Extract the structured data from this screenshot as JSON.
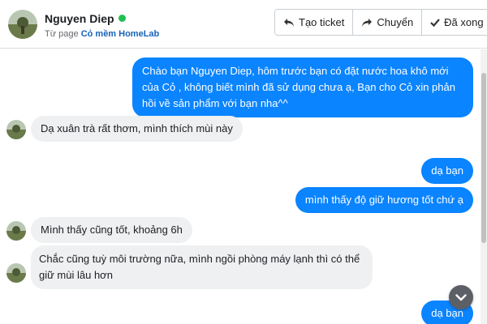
{
  "header": {
    "contact_name": "Nguyen Diep",
    "online": true,
    "source_prefix": "Từ page",
    "page_name": "Cỏ mềm HomeLab",
    "buttons": {
      "create_ticket": "Tạo ticket",
      "transfer": "Chuyển",
      "done": "Đã xong"
    }
  },
  "messages": [
    {
      "direction": "outgoing",
      "text": "Chào bạn Nguyen Diep, hôm trước bạn có đặt nước hoa khô mới của Cỏ , không biết mình đã sử dụng chưa ạ, Bạn cho Cỏ xin phản hồi về sản phẩm với bạn nha^^"
    },
    {
      "direction": "incoming",
      "text": "Dạ xuân trà rất thơm, mình thích mùi này"
    },
    {
      "direction": "outgoing",
      "text": "dạ bạn"
    },
    {
      "direction": "outgoing",
      "text": "mình thấy độ giữ hương tốt chứ ạ"
    },
    {
      "direction": "incoming",
      "text": "Mình thấy cũng tốt, khoảng 6h"
    },
    {
      "direction": "incoming",
      "text": "Chắc cũng tuỳ môi trường nữa, mình ngồi phòng máy lạnh thì có thể giữ mùi lâu hơn"
    },
    {
      "direction": "outgoing",
      "text": "dạ bạn"
    }
  ],
  "colors": {
    "outgoing_bubble": "#0a84ff",
    "incoming_bubble": "#eef0f2",
    "online_dot": "#20c050",
    "page_link": "#1762b8"
  },
  "icons": {
    "create_ticket": "reply-arrow-icon",
    "transfer": "forward-arrow-icon",
    "done": "checkmark-icon",
    "scroll_down": "chevron-down-icon"
  }
}
